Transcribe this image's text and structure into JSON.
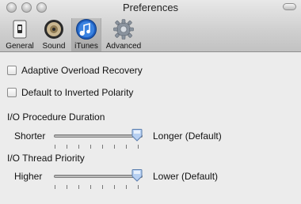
{
  "window": {
    "title": "Preferences"
  },
  "toolbar": {
    "items": [
      {
        "label": "General",
        "icon": "switch-icon"
      },
      {
        "label": "Sound",
        "icon": "speaker-icon"
      },
      {
        "label": "iTunes",
        "icon": "itunes-icon",
        "selected": true
      },
      {
        "label": "Advanced",
        "icon": "gear-icon"
      }
    ]
  },
  "options": {
    "adaptive_overload": {
      "label": "Adaptive Overload Recovery",
      "checked": false
    },
    "inverted_polarity": {
      "label": "Default to Inverted Polarity",
      "checked": false
    }
  },
  "duration": {
    "title": "I/O Procedure Duration",
    "min_label": "Shorter",
    "max_label": "Longer (Default)",
    "value_fraction": 1.0
  },
  "priority": {
    "title": "I/O Thread Priority",
    "min_label": "Higher",
    "max_label": "Lower (Default)",
    "value_fraction": 1.0
  },
  "colors": {
    "selected_icon": "#1f5fbf"
  }
}
